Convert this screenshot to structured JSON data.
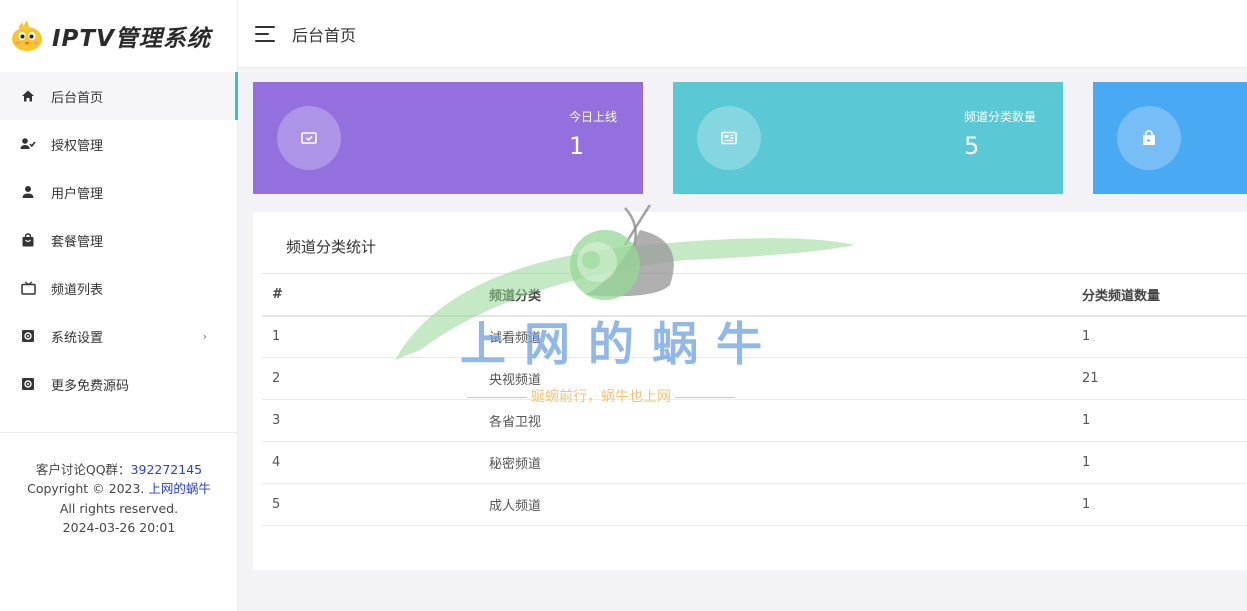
{
  "app": {
    "title": "IPTV管理系统"
  },
  "header": {
    "title": "后台首页"
  },
  "sidebar": {
    "items": [
      {
        "label": "后台首页",
        "icon": "home-icon",
        "active": true
      },
      {
        "label": "授权管理",
        "icon": "user-check-icon"
      },
      {
        "label": "用户管理",
        "icon": "user-icon"
      },
      {
        "label": "套餐管理",
        "icon": "shopping-bag-icon"
      },
      {
        "label": "频道列表",
        "icon": "tv-icon"
      },
      {
        "label": "系统设置",
        "icon": "settings-icon",
        "has_submenu": true,
        "arrow": "›"
      },
      {
        "label": "更多免费源码",
        "icon": "settings-icon"
      }
    ],
    "footer": {
      "qq_label": "客户讨论QQ群：",
      "qq_value": "392272145",
      "copyright_prefix": "Copyright © 2023. ",
      "copyright_link": "上网的蜗牛",
      "rights": "All rights reserved.",
      "datetime": "2024-03-26 20:01"
    }
  },
  "cards": [
    {
      "label": "今日上线",
      "value": "1",
      "color": "#9370de",
      "icon": "tv-check-icon"
    },
    {
      "label": "频道分类数量",
      "value": "5",
      "color": "#5bc8d6",
      "icon": "news-icon"
    },
    {
      "label": "",
      "value": "",
      "color": "#4aa9f3",
      "icon": "shopping-bag-icon"
    }
  ],
  "stats": {
    "title": "频道分类统计",
    "columns": [
      "#",
      "频道分类",
      "分类频道数量"
    ],
    "rows": [
      [
        "1",
        "试看频道",
        "1"
      ],
      [
        "2",
        "央视频道",
        "21"
      ],
      [
        "3",
        "各省卫视",
        "1"
      ],
      [
        "4",
        "秘密频道",
        "1"
      ],
      [
        "5",
        "成人频道",
        "1"
      ]
    ]
  },
  "watermark": {
    "title": "上网的蜗牛",
    "subtitle": "蜒蜿前行，蜗牛也上网"
  },
  "colors": {
    "accent": "#35c3c8",
    "link": "#2a3fd6"
  }
}
